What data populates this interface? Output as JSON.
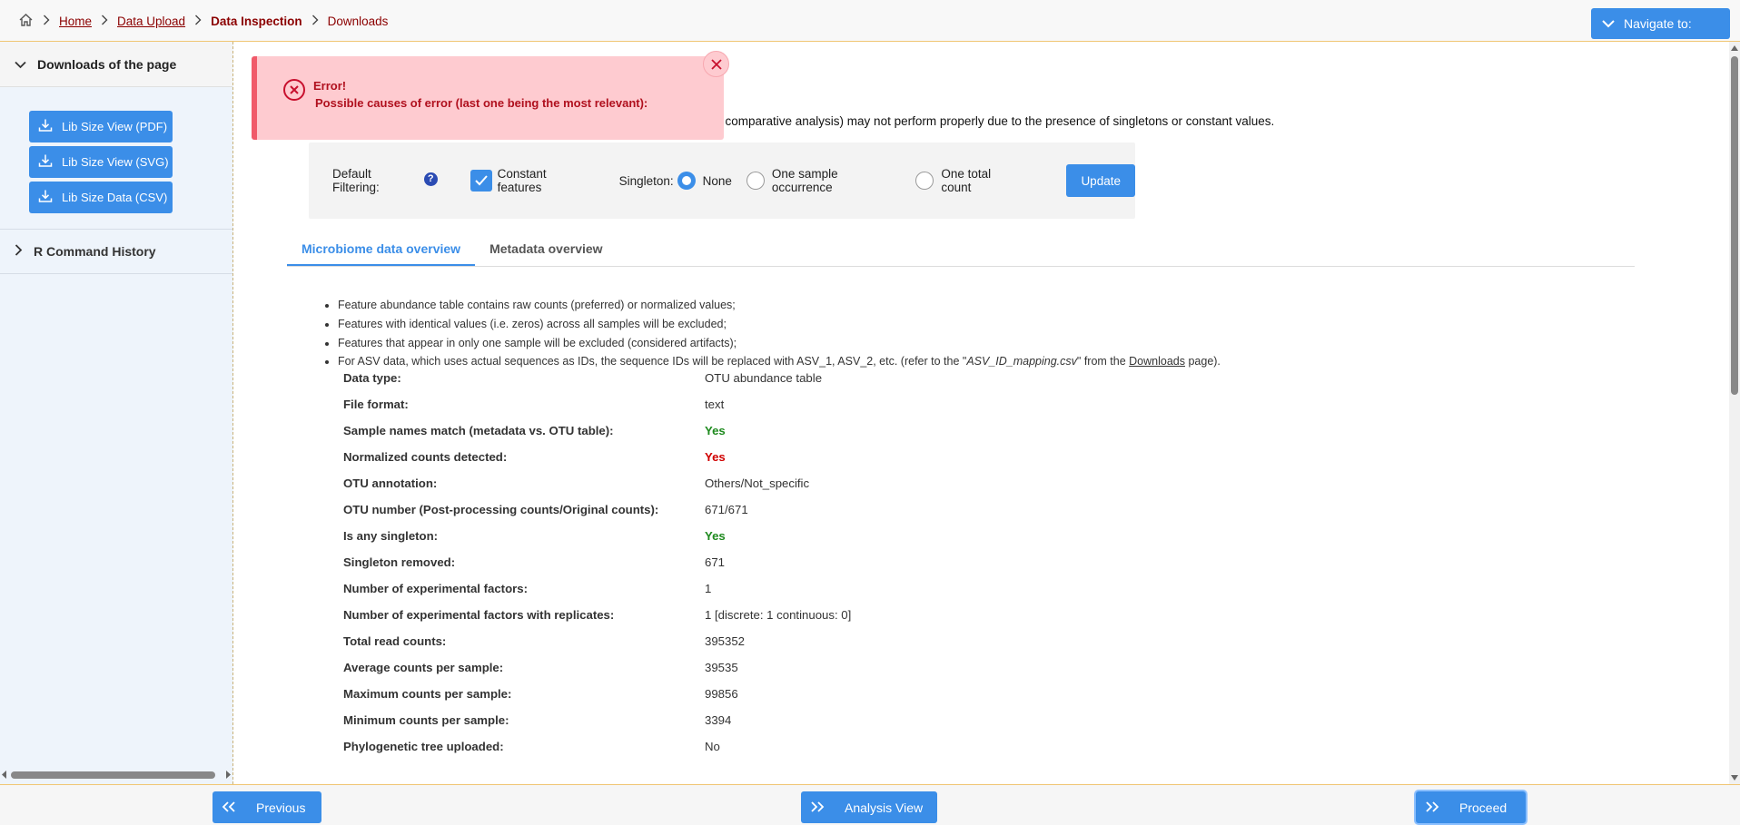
{
  "breadcrumb": {
    "items": [
      {
        "label": "Home",
        "style": "link"
      },
      {
        "label": "Data Upload",
        "style": "link"
      },
      {
        "label": "Data Inspection",
        "style": "current"
      },
      {
        "label": "Downloads",
        "style": "plain"
      }
    ]
  },
  "header": {
    "navigate_label": "Navigate to:"
  },
  "sidebar": {
    "downloads_title": "Downloads of the page",
    "downloads": [
      {
        "label": "Lib Size View (PDF)"
      },
      {
        "label": "Lib Size View (SVG)"
      },
      {
        "label": "Lib Size Data (CSV)"
      }
    ],
    "r_history_title": "R Command History"
  },
  "error": {
    "title": "Error!",
    "message": "Possible causes of error (last one being the most relevant):"
  },
  "warning_text": "y comparative analysis) may not perform properly due to the presence of singletons or constant values.",
  "filter": {
    "default_label": "Default Filtering:",
    "help": "?",
    "constant_label": "Constant features",
    "constant_checked": true,
    "singleton_label": "Singleton:",
    "options": [
      {
        "label": "None",
        "selected": true
      },
      {
        "label": "One sample occurrence",
        "selected": false
      },
      {
        "label": "One total count",
        "selected": false
      }
    ],
    "update_label": "Update"
  },
  "tabs": [
    {
      "label": "Microbiome data overview",
      "active": true
    },
    {
      "label": "Metadata overview",
      "active": false
    }
  ],
  "bullets": {
    "b1": "Feature abundance table contains raw counts (preferred) or normalized values;",
    "b2": "Features with identical values (i.e. zeros) across all samples will be excluded;",
    "b3": "Features that appear in only one sample will be excluded (considered artifacts);",
    "b4_pre": "For ASV data, which uses actual sequences as IDs, the sequence IDs will be replaced with ASV_1, ASV_2, etc. (refer to the \"",
    "b4_file": "ASV_ID_mapping.csv",
    "b4_mid": "\" from the ",
    "b4_link": "Downloads",
    "b4_post": " page)."
  },
  "info_rows": [
    {
      "key": "Data type:",
      "value": "OTU abundance table",
      "style": "normal"
    },
    {
      "key": "File format:",
      "value": "text",
      "style": "normal"
    },
    {
      "key": "Sample names match (metadata vs. OTU table):",
      "value": "Yes",
      "style": "green"
    },
    {
      "key": "Normalized counts detected:",
      "value": "Yes",
      "style": "red"
    },
    {
      "key": "OTU annotation:",
      "value": "Others/Not_specific",
      "style": "normal"
    },
    {
      "key": "OTU number (Post-processing counts/Original counts):",
      "value": "671/671",
      "style": "normal"
    },
    {
      "key": "Is any singleton:",
      "value": "Yes",
      "style": "green"
    },
    {
      "key": "Singleton removed:",
      "value": "671",
      "style": "normal"
    },
    {
      "key": "Number of experimental factors:",
      "value": "1",
      "style": "normal"
    },
    {
      "key": "Number of experimental factors with replicates:",
      "value": "1 [discrete: 1 continuous: 0]",
      "style": "normal"
    },
    {
      "key": "Total read counts:",
      "value": "395352",
      "style": "normal"
    },
    {
      "key": "Average counts per sample:",
      "value": "39535",
      "style": "normal"
    },
    {
      "key": "Maximum counts per sample:",
      "value": "99856",
      "style": "normal"
    },
    {
      "key": "Minimum counts per sample:",
      "value": "3394",
      "style": "normal"
    },
    {
      "key": "Phylogenetic tree uploaded:",
      "value": "No",
      "style": "normal"
    }
  ],
  "bottom": {
    "previous": "Previous",
    "analysis_view": "Analysis View",
    "proceed": "Proceed"
  },
  "colors": {
    "accent": "#3b8ee8",
    "breadcrumb": "#8b0000",
    "error_bg": "#fecbd0",
    "error_text": "#b0101e",
    "ok_green": "#1e8a1e",
    "alert_red": "#d00000"
  },
  "icons": {
    "home": "home-icon",
    "chevron": "chevron-right-icon",
    "download": "download-icon",
    "error": "error-circle-icon",
    "close": "close-icon",
    "double_left": "double-chevron-left-icon",
    "double_right": "double-chevron-right-icon"
  }
}
